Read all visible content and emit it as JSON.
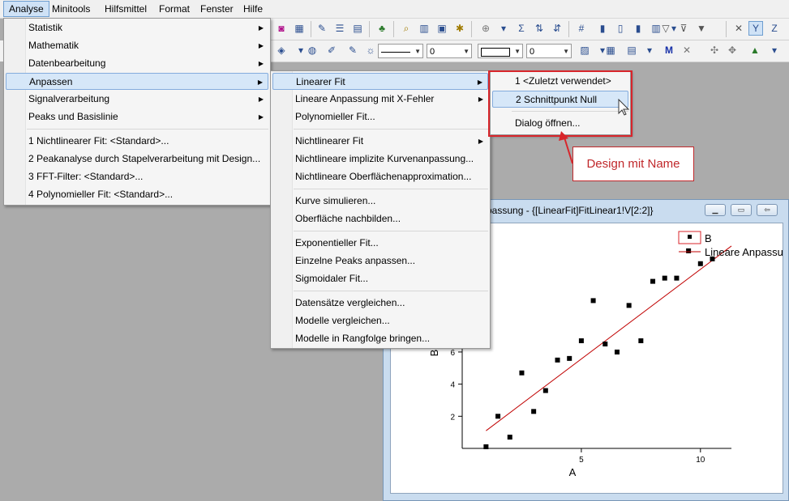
{
  "menubar": [
    "Analyse",
    "Minitools",
    "Hilfsmittel",
    "Format",
    "Fenster",
    "Hilfe"
  ],
  "combos": [
    "0",
    "0"
  ],
  "menu1": {
    "items": [
      "Statistik",
      "Mathematik",
      "Datenbearbeitung",
      "Anpassen",
      "Signalverarbeitung",
      "Peaks und Basislinie"
    ],
    "recent": [
      "1 Nichtlinearer Fit: <Standard>...",
      "2 Peakanalyse durch Stapelverarbeitung mit Design...",
      "3 FFT-Filter: <Standard>...",
      "4 Polynomieller Fit: <Standard>..."
    ]
  },
  "menu2": {
    "group1": [
      "Linearer Fit",
      "Lineare Anpassung mit X-Fehler",
      "Polynomieller Fit..."
    ],
    "group2": [
      "Nichtlinearer Fit",
      "Nichtlineare implizite Kurvenanpassung...",
      "Nichtlineare Oberflächenapproximation..."
    ],
    "group3": [
      "Kurve simulieren...",
      "Oberfläche nachbilden..."
    ],
    "group4": [
      "Exponentieller Fit...",
      "Einzelne Peaks anpassen...",
      "Sigmoidaler Fit..."
    ],
    "group5": [
      "Datensätze vergleichen...",
      "Modelle vergleichen...",
      "Modelle in Rangfolge bringen..."
    ]
  },
  "menu3": {
    "items": [
      "1 <Zuletzt verwendet>",
      "2 Schnittpunkt Null"
    ],
    "dialog": "Dialog öffnen..."
  },
  "callout": "Design mit Name",
  "graph_window": {
    "title": "passung - {[LinearFit]FitLinear1!V[2:2]}"
  },
  "colors": {
    "annotation": "#d8252b",
    "fit_line": "#c00000"
  },
  "chart_data": {
    "type": "scatter",
    "xlabel": "A",
    "ylabel": "B",
    "x_ticks": [
      "5",
      "10"
    ],
    "y_ticks": [
      "2",
      "4",
      "6"
    ],
    "xlim": [
      0,
      11.3
    ],
    "ylim": [
      0,
      13
    ],
    "legend": [
      "B",
      "Lineare Anpassu"
    ],
    "series": [
      {
        "name": "B",
        "x": [
          1.0,
          1.5,
          2.0,
          2.5,
          3.0,
          3.5,
          4.0,
          4.5,
          5.0,
          5.5,
          6.0,
          6.5,
          7.0,
          7.5,
          8.0,
          8.5,
          9.0,
          9.5,
          10.0,
          10.5
        ],
        "y": [
          0.1,
          2.0,
          0.7,
          4.7,
          2.3,
          3.6,
          5.5,
          5.6,
          6.7,
          9.2,
          6.5,
          6.0,
          8.9,
          6.7,
          10.4,
          10.6,
          10.6,
          12.3,
          11.5,
          11.8
        ]
      },
      {
        "name": "Lineare Anpassu",
        "x": [
          1.0,
          11.3
        ],
        "y": [
          1.1,
          12.6
        ]
      }
    ]
  }
}
